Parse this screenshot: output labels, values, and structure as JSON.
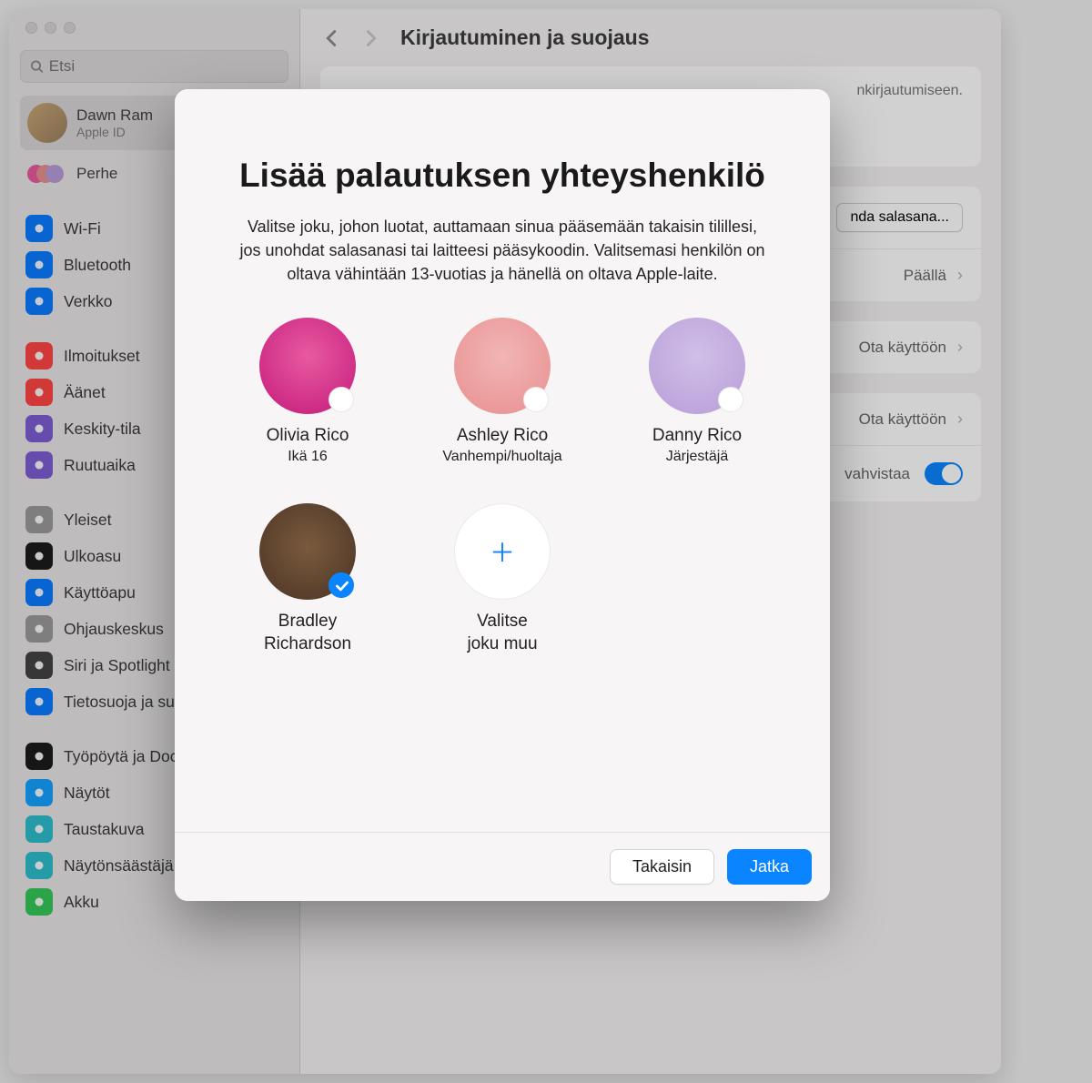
{
  "search": {
    "placeholder": "Etsi"
  },
  "account": {
    "name": "Dawn Ram",
    "sub": "Apple ID"
  },
  "family_label": "Perhe",
  "sidebar_groups": [
    [
      {
        "key": "wifi",
        "label": "Wi-Fi",
        "color": "#0a7aff"
      },
      {
        "key": "bluetooth",
        "label": "Bluetooth",
        "color": "#0a7aff"
      },
      {
        "key": "network",
        "label": "Verkko",
        "color": "#0a7aff"
      }
    ],
    [
      {
        "key": "notifications",
        "label": "Ilmoitukset",
        "color": "#ff4646"
      },
      {
        "key": "sounds",
        "label": "Äänet",
        "color": "#ff4646"
      },
      {
        "key": "focus",
        "label": "Keskity-tila",
        "color": "#7d5fd3"
      },
      {
        "key": "screentime",
        "label": "Ruutuaika",
        "color": "#7d5fd3"
      }
    ],
    [
      {
        "key": "general",
        "label": "Yleiset",
        "color": "#9a9a9a"
      },
      {
        "key": "appearance",
        "label": "Ulkoasu",
        "color": "#1c1c1c"
      },
      {
        "key": "accessibility",
        "label": "Käyttöapu",
        "color": "#0a7aff"
      },
      {
        "key": "controlcenter",
        "label": "Ohjauskeskus",
        "color": "#9a9a9a"
      },
      {
        "key": "siri",
        "label": "Siri ja Spotlight",
        "color": "#444"
      },
      {
        "key": "privacy",
        "label": "Tietosuoja ja suojaus",
        "color": "#0a7aff"
      }
    ],
    [
      {
        "key": "desktop",
        "label": "Työpöytä ja Dock",
        "color": "#1c1c1c"
      },
      {
        "key": "displays",
        "label": "Näytöt",
        "color": "#14a0ff"
      },
      {
        "key": "wallpaper",
        "label": "Taustakuva",
        "color": "#2dbecb"
      },
      {
        "key": "screensaver",
        "label": "Näytönsäästäjä",
        "color": "#2dbecb"
      },
      {
        "key": "battery",
        "label": "Akku",
        "color": "#34c759"
      }
    ]
  ],
  "page_title": "Kirjautuminen ja suojaus",
  "bg": {
    "signin_suffix": "nkirjautumiseen.",
    "change_pwd": "nda salasana...",
    "on": "Päällä",
    "enable": "Ota käyttöön",
    "confirm": "vahvistaa"
  },
  "modal": {
    "title": "Lisää palautuksen yhteyshenkilö",
    "desc": "Valitse joku, johon luotat, auttamaan sinua pääsemään takaisin tilillesi, jos unohdat salasanasi tai laitteesi pääsykoodin. Valitsemasi henkilön on oltava vähintään 13-vuotias ja hänellä on oltava Apple-laite.",
    "people": [
      {
        "name": "Olivia Rico",
        "sub": "Ikä 16",
        "cls": "av1"
      },
      {
        "name": "Ashley Rico",
        "sub": "Vanhempi/huoltaja",
        "cls": "av2"
      },
      {
        "name": "Danny Rico",
        "sub": "Järjestäjä",
        "cls": "av3"
      },
      {
        "name": "Bradley\nRichardson",
        "sub": "",
        "cls": "av4",
        "selected": true
      }
    ],
    "choose_other": "Valitse\njoku muu",
    "back": "Takaisin",
    "continue": "Jatka"
  }
}
